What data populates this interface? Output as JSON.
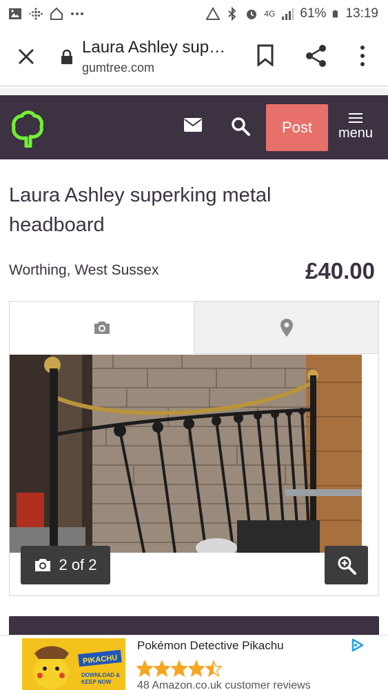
{
  "status_bar": {
    "battery": "61%",
    "time": "13:19",
    "network": "4G"
  },
  "browser": {
    "page_title": "Laura Ashley sup…",
    "url": "gumtree.com"
  },
  "header": {
    "post_label": "Post",
    "menu_label": "menu"
  },
  "listing": {
    "title": "Laura Ashley superking metal headboard",
    "location": "Worthing, West Sussex",
    "price": "£40.00"
  },
  "gallery": {
    "tabs": [
      {
        "icon": "camera-icon"
      },
      {
        "icon": "map-pin-icon"
      }
    ],
    "counter": "2 of 2"
  },
  "ad": {
    "title": "Pokémon Detective Pikachu",
    "rating": 4.5,
    "reviews": "48 Amazon.co.uk customer reviews",
    "image_text": [
      "PIKACHU",
      "DOWNLOAD &",
      "KEEP NOW"
    ]
  },
  "colors": {
    "header_bg": "#3c3241",
    "post_button": "#e8706a",
    "logo_green": "#72ef36",
    "ad_choices": "#1fa0e8",
    "star": "#f5a623"
  }
}
